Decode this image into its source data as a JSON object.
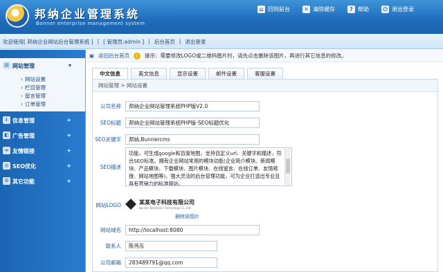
{
  "header": {
    "title": "邦纳企业管理系统",
    "subtitle": "Bonner enterprise management system",
    "links": [
      {
        "label": "回到前台",
        "icon": "home-icon"
      },
      {
        "label": "清除缓存",
        "icon": "trash-icon"
      },
      {
        "label": "帮助",
        "icon": "help-icon"
      },
      {
        "label": "退出登录",
        "icon": "logout-icon"
      }
    ]
  },
  "userbar": {
    "welcome": "欢迎使用[ 邦纳企业网站后台管理系统 ]",
    "admin": "[ 管理员:admin ]",
    "backhome": "后台首页",
    "logout": "退出登录"
  },
  "sidebar": {
    "active_label": "网站管理",
    "sub_items": [
      "网站设置",
      "栏目管理",
      "留言管理",
      "订单管理"
    ],
    "groups": [
      "信息管理",
      "广告管理",
      "友情链接",
      "SEO优化",
      "其它功能"
    ]
  },
  "notice": {
    "home_link": "返回后台首页",
    "tip": "提示：需要修改LOGO或二维码图片时，请先点击删除该图片，再进行其它信息的修改。"
  },
  "tabs": [
    "中文信息",
    "英文信息",
    "显示设置",
    "邮件设置",
    "客服设置"
  ],
  "crumb": "网站管理 > 网站设置",
  "form": {
    "company_label": "公司名称",
    "company_value": "邦纳企业网站管理系统PHP版V2.0",
    "seo_title_label": "SEO标题",
    "seo_title_value": "邦纳企业网站管理系统PHP版-SEO标题优化",
    "seo_kw_label": "SEO关键字",
    "seo_kw_value": "邦纳,Bunnercms",
    "seo_desc_label": "SEO描述",
    "seo_desc_value": "功能，可生成google和百度地图，支持自定义url、关键字和描述，符合SEO标准。拥有企业网站常用的模块功能(企业简介模块、新闻模块、产品模块、下载模块、图片模块、在线留言、在线订单、友情链接、网站地图等)，强大灵活的后台管理功能，可为企业打造出专业且具有营销力的标准网站。",
    "logo_label": "网站LOGO",
    "logo_cn": "某某电子科技有限公司",
    "logo_en": "Bunner Electronic Technology Co.,Ltd.",
    "logo_delete": "删除该图片",
    "domain_label": "网站域名",
    "domain_value": "http://localhost:8080",
    "contact_label": "联系人",
    "contact_value": "陈伟东",
    "email_label": "公司邮箱",
    "email_value": "283489791@qq.com"
  }
}
